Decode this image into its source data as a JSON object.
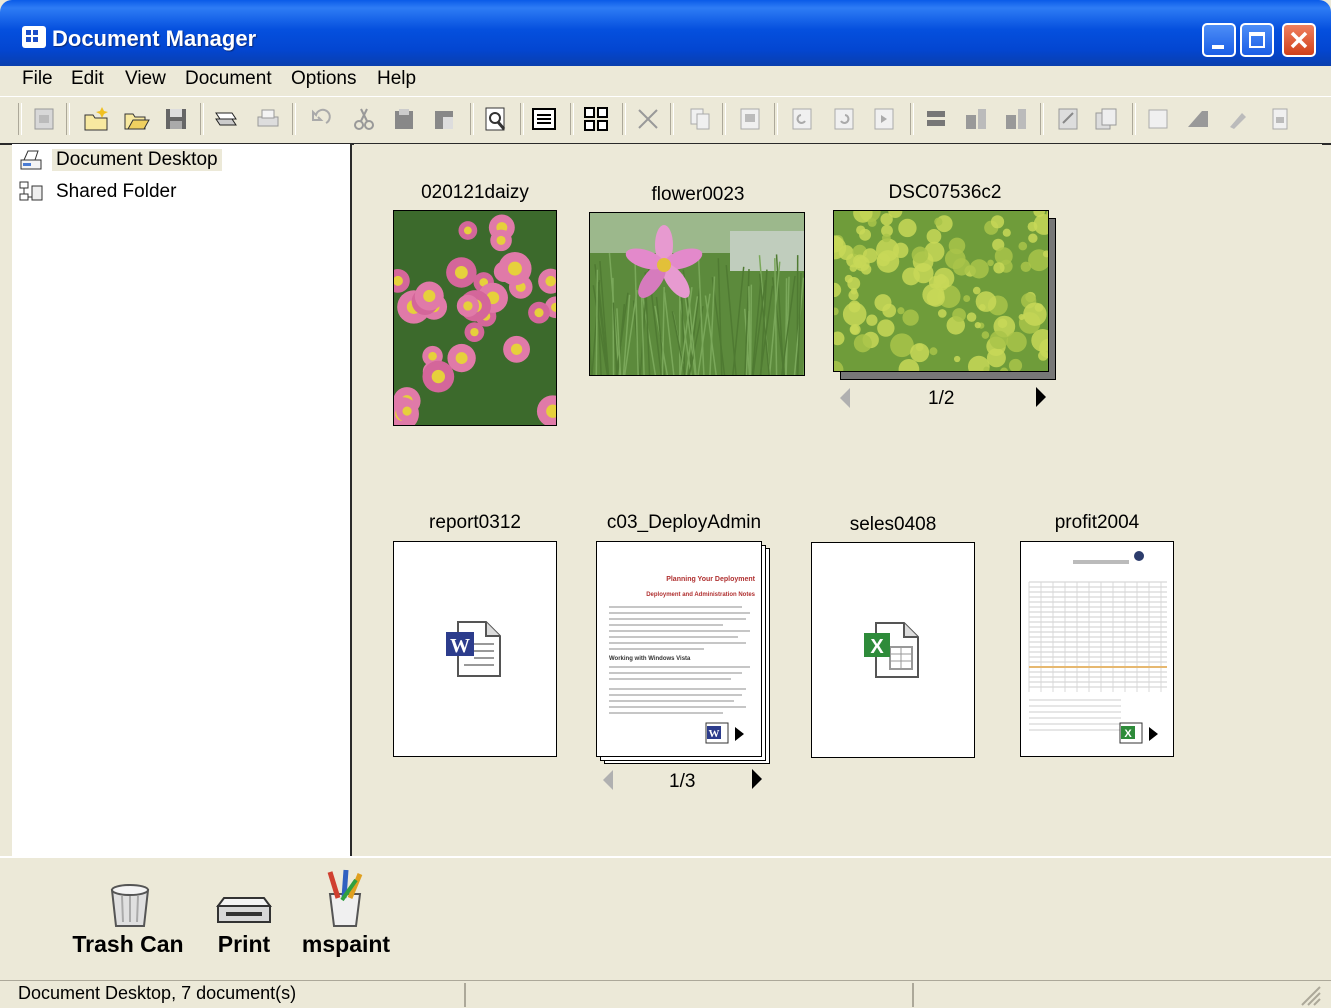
{
  "window": {
    "title": "Document Manager"
  },
  "menu": [
    "File",
    "Edit",
    "View",
    "Document",
    "Options",
    "Help"
  ],
  "tree": [
    {
      "label": "Document Desktop",
      "icon": "document-desktop-icon",
      "selected": true
    },
    {
      "label": "Shared Folder",
      "icon": "shared-folder-icon",
      "selected": false
    }
  ],
  "documents": [
    {
      "name": "020121daizy",
      "kind": "photo-flowers-pink"
    },
    {
      "name": "flower0023",
      "kind": "photo-cosmos"
    },
    {
      "name": "DSC07536c2",
      "kind": "photo-yellow-field",
      "pager": "1/2"
    },
    {
      "name": "report0312",
      "kind": "word-icon"
    },
    {
      "name": "c03_DeployAdmin",
      "kind": "document-page",
      "pager": "1/3",
      "page_title": "Planning Your Deployment",
      "page_subtitle": "Deployment and Administration Notes",
      "page_heading": "Working with Windows Vista"
    },
    {
      "name": "seles0408",
      "kind": "excel-icon"
    },
    {
      "name": "profit2004",
      "kind": "spreadsheet-page"
    }
  ],
  "tray": [
    {
      "label": "Trash Can",
      "icon": "trash-can-icon"
    },
    {
      "label": "Print",
      "icon": "printer-icon"
    },
    {
      "label": "mspaint",
      "icon": "mspaint-brushes-icon"
    }
  ],
  "status": {
    "text": "Document Desktop, 7 document(s)"
  },
  "colors": {
    "titlebar": "#0550de",
    "face": "#ece9d8",
    "word_blue": "#2c3c8c",
    "excel_green": "#2e8b3a"
  }
}
